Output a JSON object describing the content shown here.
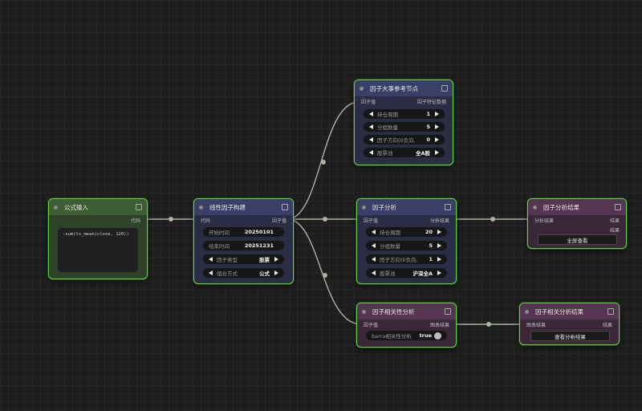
{
  "nodes": {
    "formula_input": {
      "title": "公式输入",
      "output": "代码",
      "formula": "-sum(ts_mean(close, 120))"
    },
    "linear_factor": {
      "title": "线性因子构建",
      "input": "代码",
      "output": "因子值",
      "start_label": "开始时间",
      "start_value": "20250101",
      "end_label": "结束时间",
      "end_value": "20251231",
      "type_label": "因子类型",
      "type_value": "股票",
      "mode_label": "组合方式",
      "mode_value": "公式"
    },
    "factor_large": {
      "title": "因子大事参考节点",
      "input": "因子值",
      "output": "因子特征数据",
      "period_label": "持仓周期",
      "period_value": "1",
      "groups_label": "分组数量",
      "groups_value": "5",
      "direction_label": "因子方向(0负向,",
      "direction_value": "0",
      "pool_label": "股票池",
      "pool_value": "全A股"
    },
    "factor_analysis": {
      "title": "因子分析",
      "input": "因子值",
      "output": "分析结果",
      "period_label": "持仓周期",
      "period_value": "20",
      "groups_label": "分组数量",
      "groups_value": "5",
      "direction_label": "因子方向(0负向,",
      "direction_value": "1",
      "pool_label": "股票池",
      "pool_value": "沪深全A"
    },
    "analysis_result": {
      "title": "因子分析结果",
      "input": "分析结果",
      "out1": "结果",
      "out2": "结果",
      "button": "全屏查看"
    },
    "correlation": {
      "title": "因子相关性分析",
      "input": "因子值",
      "output": "图表结果",
      "toggle_label": "barra相关性分析",
      "toggle_value": "true"
    },
    "correlation_result": {
      "title": "因子相关分析结果",
      "input": "图表结果",
      "output": "结果",
      "button": "查看分析结果"
    }
  },
  "colors": {
    "node_border": "#5fd33a",
    "link": "#a8b4a4",
    "blue_header": "#3b3f68",
    "green_header": "#3e5d35",
    "purple_header": "#553652"
  }
}
